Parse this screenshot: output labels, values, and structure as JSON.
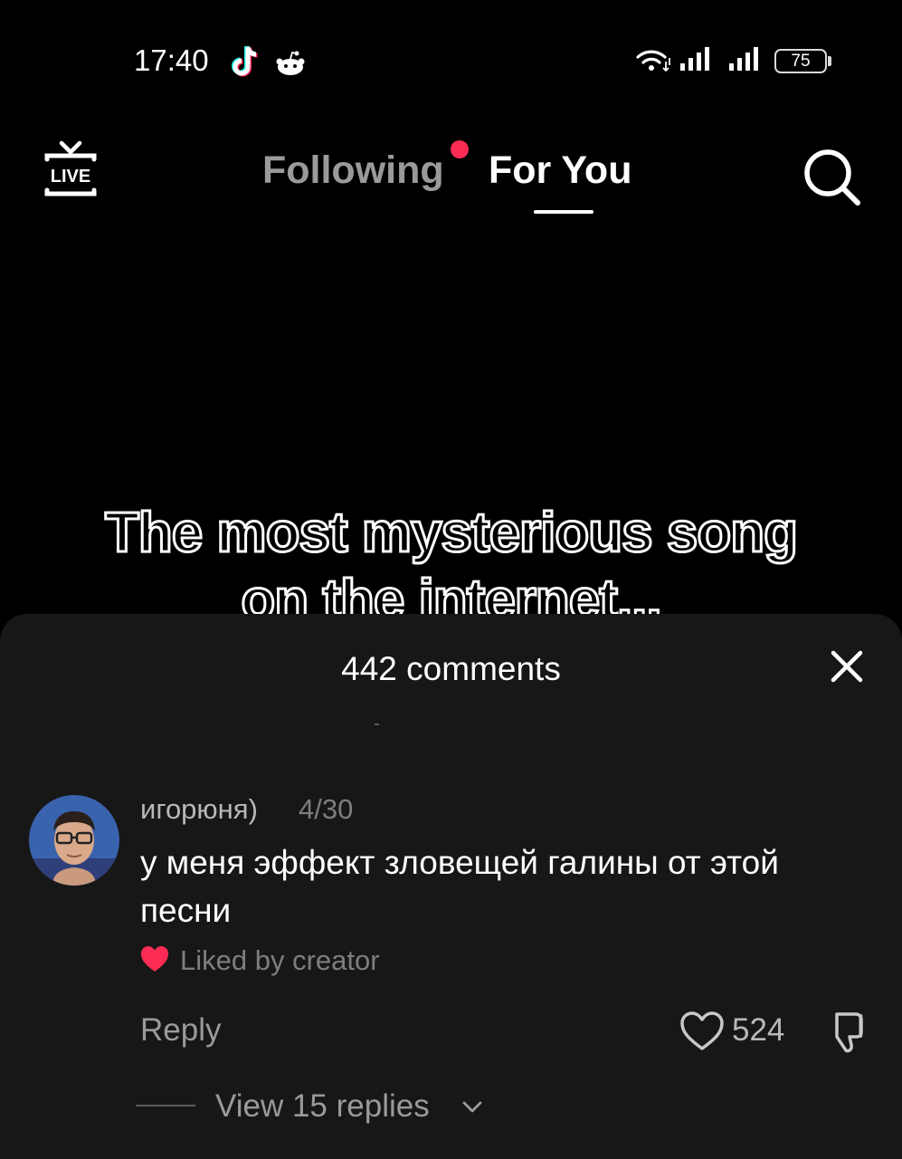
{
  "status_bar": {
    "time": "17:40",
    "battery": "75",
    "icons": [
      "tiktok-icon",
      "reddit-icon",
      "wifi-icon",
      "signal-icon",
      "signal-icon",
      "battery-icon"
    ]
  },
  "nav": {
    "tabs": [
      {
        "label": "Following",
        "active": false
      },
      {
        "label": "For You",
        "active": true
      }
    ],
    "icons": [
      "live-icon",
      "search-icon"
    ]
  },
  "video": {
    "caption_line1": "The most mysterious song",
    "caption_line2": "on the internet..."
  },
  "comments": {
    "count_label": "442 comments",
    "items": [
      {
        "user": "игорюня)",
        "date": "4/30",
        "text": "у меня эффект зловещей галины от этой песни",
        "liked_by_creator": "Liked by creator",
        "reply_label": "Reply",
        "likes": "524",
        "view_replies": "View 15 replies"
      }
    ]
  },
  "colors": {
    "background": "#000000",
    "sheet": "#171717",
    "accent": "#fe2c55",
    "muted_text": "#7e7e7e"
  }
}
